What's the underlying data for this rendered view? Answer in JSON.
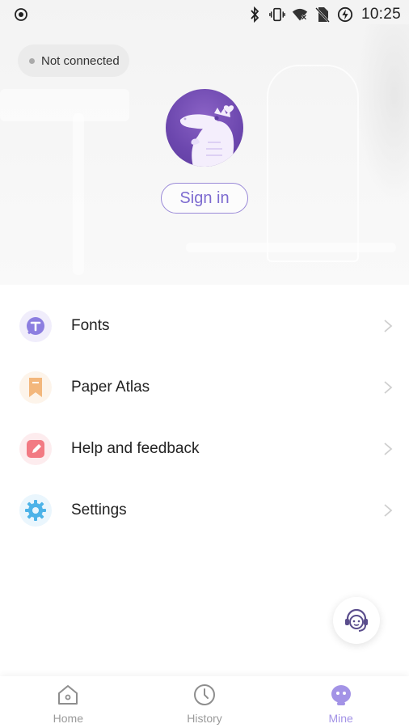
{
  "status_bar": {
    "time": "10:25",
    "icons": [
      "record-icon",
      "bluetooth-icon",
      "vibrate-icon",
      "wifi-icon",
      "no-sim-icon",
      "battery-charging-icon"
    ]
  },
  "connection": {
    "label": "Not connected"
  },
  "profile": {
    "avatar": "crocodile-avatar",
    "sign_in_label": "Sign in"
  },
  "menu": {
    "items": [
      {
        "label": "Fonts",
        "icon": "fonts-icon",
        "color": "#8c7ee0"
      },
      {
        "label": "Paper Atlas",
        "icon": "bookmark-icon",
        "color": "#f3b77c"
      },
      {
        "label": "Help and feedback",
        "icon": "edit-icon",
        "color": "#f27a83"
      },
      {
        "label": "Settings",
        "icon": "gear-icon",
        "color": "#4db3e8"
      }
    ]
  },
  "support": {
    "icon": "customer-service-icon"
  },
  "bottom_nav": {
    "items": [
      {
        "label": "Home",
        "icon": "home-icon",
        "active": false
      },
      {
        "label": "History",
        "icon": "clock-icon",
        "active": false
      },
      {
        "label": "Mine",
        "icon": "robot-face-icon",
        "active": true
      }
    ],
    "active_color": "#a393e6"
  }
}
